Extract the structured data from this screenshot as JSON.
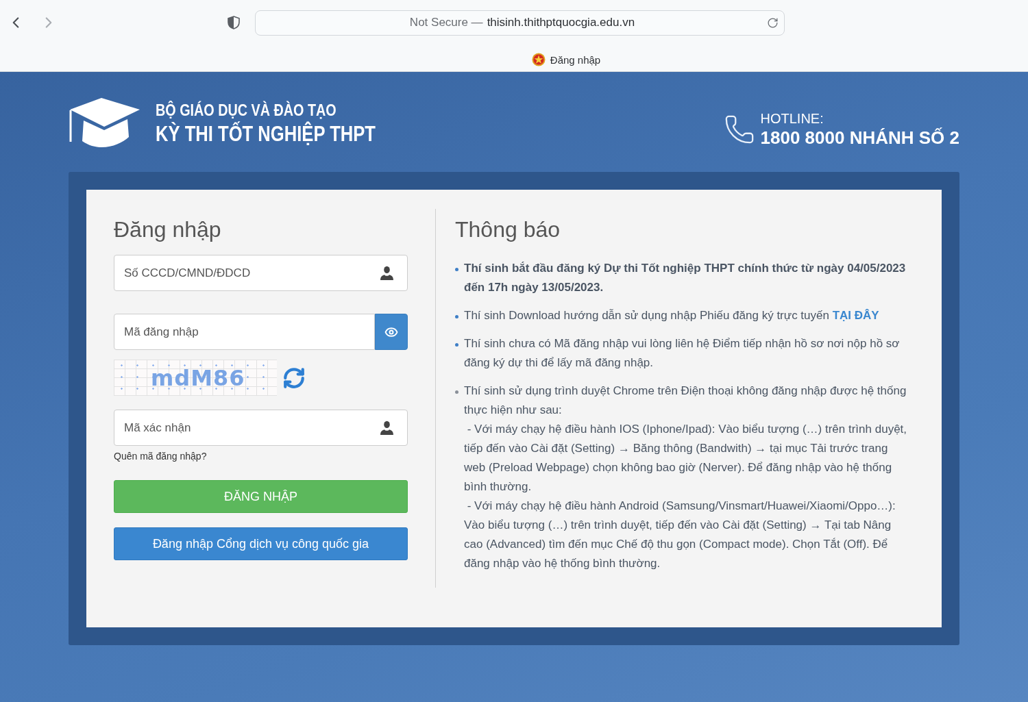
{
  "browser": {
    "back": {
      "disabled": false
    },
    "forward": {
      "disabled": true
    },
    "address": {
      "security_label": "Not Secure —",
      "url": "thisinh.thithptquocgia.edu.vn"
    },
    "tab": {
      "title": "Đăng nhập"
    }
  },
  "header": {
    "org": "BỘ GIÁO DỤC VÀ ĐÀO TẠO",
    "title": "KỲ THI TỐT NGHIỆP THPT",
    "hotline": {
      "label": "HOTLINE:",
      "number": "1800 8000 NHÁNH SỐ 2"
    }
  },
  "login": {
    "heading": "Đăng nhập",
    "fields": [
      {
        "kind": "user",
        "placeholder": "Số CCCD/CMND/ĐDCD"
      },
      {
        "kind": "password",
        "placeholder": "Mã đăng nhập"
      },
      {
        "kind": "captcha",
        "code": "mdM86"
      },
      {
        "kind": "user",
        "placeholder": "Mã xác nhận"
      }
    ],
    "forgot_link": "Quên mã đăng nhập?",
    "buttons": [
      {
        "kind": "primary",
        "label": "ĐĂNG NHẬP"
      },
      {
        "kind": "secondary",
        "label": "Đăng nhập Cổng dịch vụ công quốc gia"
      }
    ]
  },
  "notices": {
    "heading": "Thông báo",
    "items": [
      {
        "kind": "bold",
        "color": "#3f7fc6",
        "text": "Thí sinh bắt đầu đăng ký Dự thi Tốt nghiệp THPT chính thức từ ngày 04/05/2023 đến 17h ngày 13/05/2023."
      },
      {
        "kind": "plain",
        "color": "#3f7fc6",
        "text": "Thí sinh Download hướng dẫn sử dụng nhập Phiếu đăng ký trực tuyến",
        "link": "TẠI ĐÂY"
      },
      {
        "kind": "plain",
        "color": "#3f7fc6",
        "text": "Thí sinh chưa có Mã đăng nhập vui lòng liên hệ Điểm tiếp nhận hồ sơ nơi nộp hồ sơ đăng ký dự thi để lấy mã đăng nhập."
      },
      {
        "kind": "plain",
        "color": "#8a9099",
        "text": "Thí sinh sử dụng trình duyệt Chrome trên Điện thoại không đăng nhập được hệ thống thực hiện như sau:\n - Với máy chạy hệ điều hành IOS (Iphone/Ipad): Vào biểu tượng (…) trên trình duyệt, tiếp đến vào Cài đặt (Setting) → Băng thông (Bandwith) → tại mục Tải trước trang web (Preload Webpage) chọn không bao giờ (Nerver). Để đăng nhập vào hệ thống bình thường.\n - Với máy chạy hệ điều hành Android (Samsung/Vinsmart/Huawei/Xiaomi/Oppo…): Vào biểu tượng (…) trên trình duyệt, tiếp đến vào Cài đặt (Setting) → Tại tab Nâng cao (Advanced) tìm đến mục Chế độ thu gọn (Compact mode). Chọn Tắt (Off). Để đăng nhập vào hệ thống bình thường."
      }
    ]
  }
}
